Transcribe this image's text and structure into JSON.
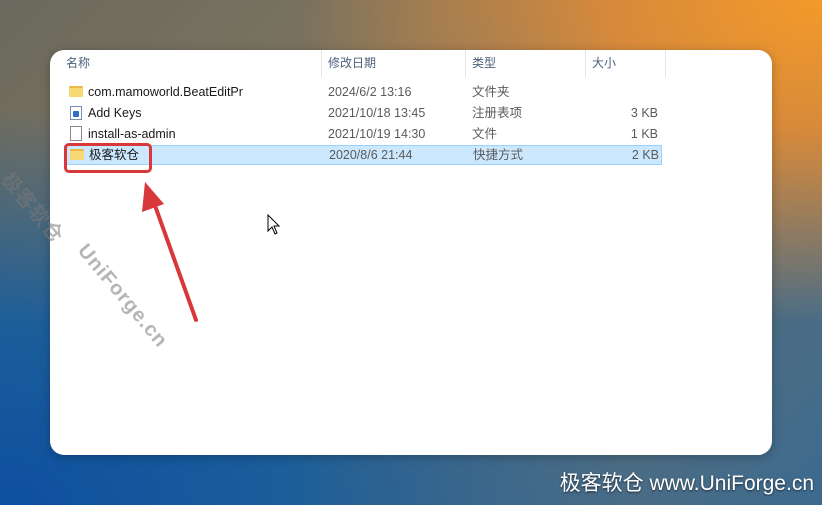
{
  "columns": {
    "name": "名称",
    "date": "修改日期",
    "type": "类型",
    "size": "大小"
  },
  "files": [
    {
      "name": "com.mamoworld.BeatEditPr",
      "date": "2024/6/2 13:16",
      "type": "文件夹",
      "size": "",
      "icon": "folder-icon"
    },
    {
      "name": "Add Keys",
      "date": "2021/10/18 13:45",
      "type": "注册表项",
      "size": "3 KB",
      "icon": "registry-file-icon"
    },
    {
      "name": "install-as-admin",
      "date": "2021/10/19 14:30",
      "type": "文件",
      "size": "1 KB",
      "icon": "file-icon"
    },
    {
      "name": "极客软仓",
      "date": "2020/8/6 21:44",
      "type": "快捷方式",
      "size": "2 KB",
      "icon": "folder-shortcut-icon",
      "selected": true
    }
  ],
  "watermark": {
    "diagonal_cn": "极客软仓",
    "diagonal_en": "UniForge.cn",
    "bottom": "极客软仓 www.UniForge.cn"
  },
  "colors": {
    "selection": "#cce8ff",
    "selection_border": "#99d1ff",
    "annotation": "#d9383a"
  }
}
